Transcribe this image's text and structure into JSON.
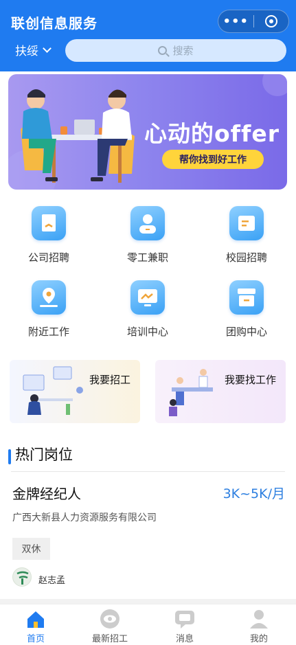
{
  "header": {
    "title": "联创信息服务",
    "city": "扶绥",
    "search_placeholder": "搜索",
    "accent": "#1f7bf0"
  },
  "banner": {
    "title": "心动的offer",
    "subtitle": "帮你找到好工作"
  },
  "menu": [
    {
      "label": "公司招聘",
      "icon": "bookmark-icon"
    },
    {
      "label": "零工兼职",
      "icon": "person-icon"
    },
    {
      "label": "校园招聘",
      "icon": "document-icon"
    },
    {
      "label": "附近工作",
      "icon": "map-pin-icon"
    },
    {
      "label": "培训中心",
      "icon": "monitor-chart-icon"
    },
    {
      "label": "团购中心",
      "icon": "store-icon"
    }
  ],
  "entries": {
    "hire": "我要招工",
    "find": "我要找工作"
  },
  "section": {
    "title": "热门岗位"
  },
  "job": {
    "title": "金牌经纪人",
    "salary": "3K~5K/月",
    "company": "广西大新县人力资源服务有限公司",
    "tag": "双休",
    "recruiter": "赵志孟"
  },
  "tabbar": [
    {
      "label": "首页",
      "icon": "home-icon",
      "active": true
    },
    {
      "label": "最新招工",
      "icon": "eye-icon",
      "active": false
    },
    {
      "label": "消息",
      "icon": "message-icon",
      "active": false
    },
    {
      "label": "我的",
      "icon": "user-icon",
      "active": false
    }
  ]
}
